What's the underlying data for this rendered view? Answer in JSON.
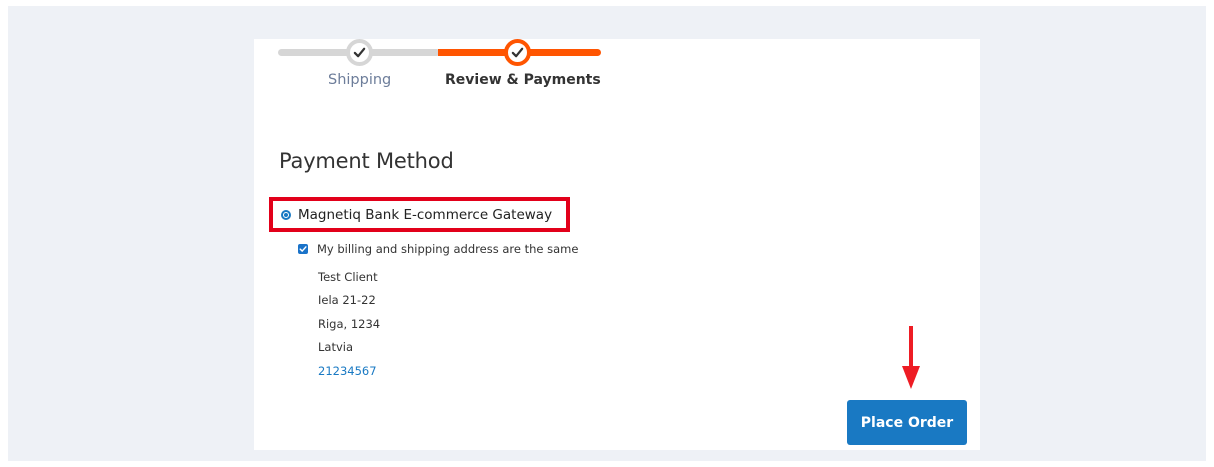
{
  "progress": {
    "steps": [
      {
        "label": "Shipping",
        "state": "complete"
      },
      {
        "label": "Review & Payments",
        "state": "active"
      }
    ]
  },
  "payment": {
    "section_title": "Payment Method",
    "method_label": "Magnetiq Bank E-commerce Gateway",
    "method_selected": true,
    "billing_same_label": "My billing and shipping address are the same",
    "billing_same_checked": true,
    "address": {
      "name": "Test Client",
      "street": "Iela 21-22",
      "city_zip": "Riga, 1234",
      "country": "Latvia",
      "phone": "21234567"
    }
  },
  "actions": {
    "place_order_label": "Place Order"
  },
  "colors": {
    "accent_orange": "#ff5501",
    "primary_blue": "#1979c3",
    "highlight_red": "#e2001a"
  }
}
